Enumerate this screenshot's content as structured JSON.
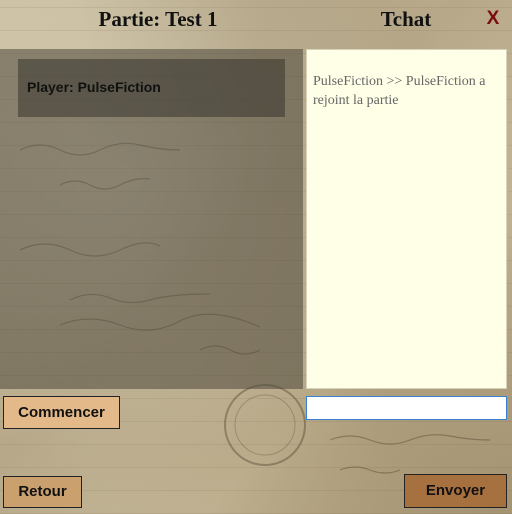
{
  "game": {
    "title": "Partie: Test 1"
  },
  "chat": {
    "title": "Tchat",
    "close_label": "X",
    "messages": [
      "PulseFiction >> PulseFiction a rejoint la partie"
    ],
    "input_value": "",
    "send_label": "Envoyer"
  },
  "players": {
    "items": [
      "Player: PulseFiction"
    ]
  },
  "actions": {
    "start_label": "Commencer",
    "back_label": "Retour"
  },
  "colors": {
    "start_button": "#e3b98a",
    "back_button": "#c9a06e",
    "send_button": "#a7703f",
    "close_icon": "#7a0d0d",
    "chat_background": "#ffffe8"
  }
}
